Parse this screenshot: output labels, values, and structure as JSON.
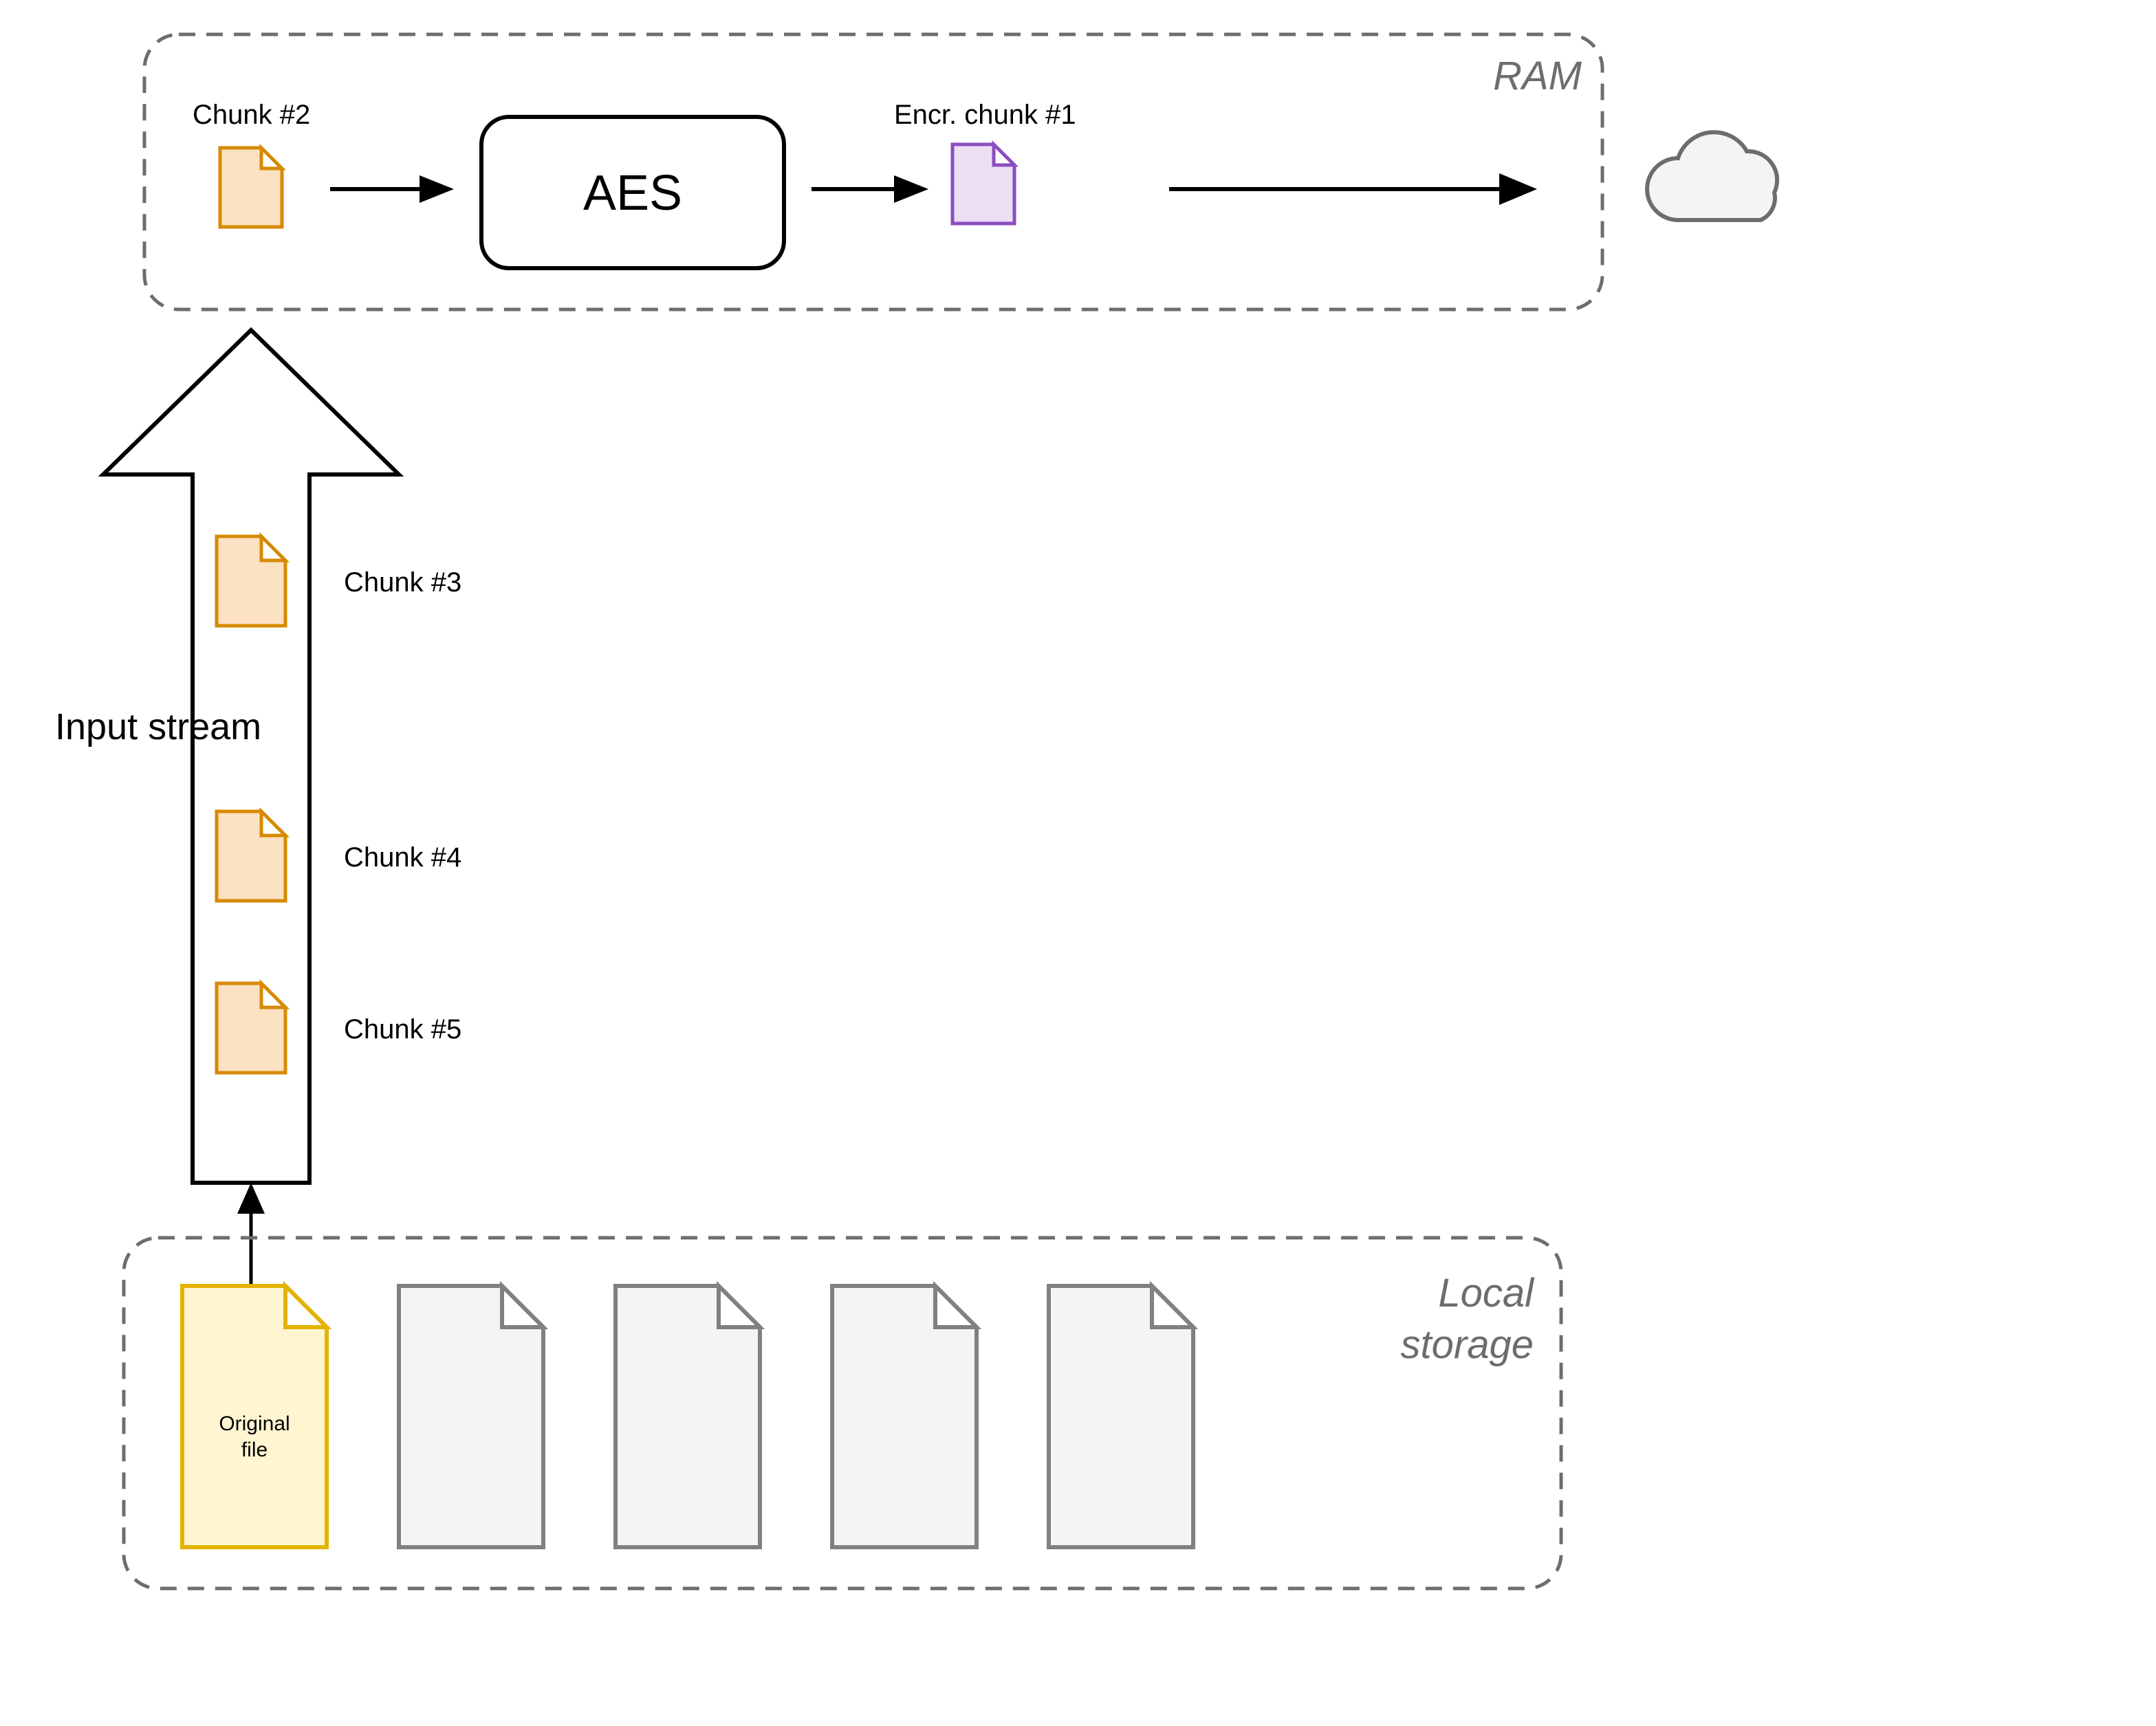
{
  "ram": {
    "title": "RAM",
    "chunk_in_label": "Chunk #2",
    "aes_label": "AES",
    "encr_chunk_label": "Encr. chunk #1"
  },
  "stream": {
    "title": "Input stream",
    "chunks": [
      "Chunk #3",
      "Chunk #4",
      "Chunk #5"
    ]
  },
  "local": {
    "title_line1": "Local",
    "title_line2": "storage",
    "original_label_line1": "Original",
    "original_label_line2": "file"
  }
}
